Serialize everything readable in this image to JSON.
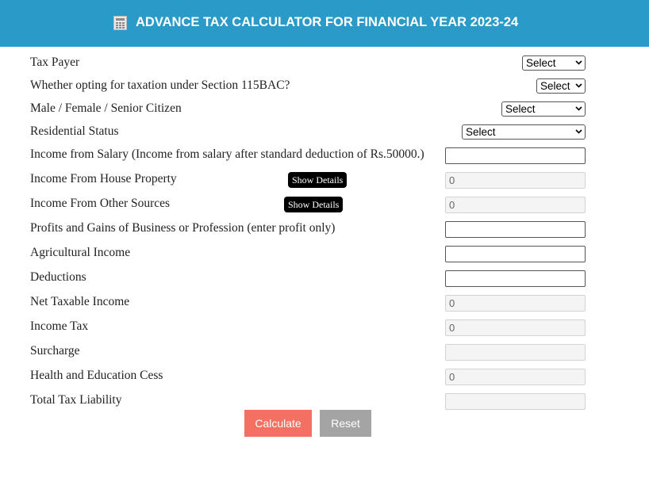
{
  "header": {
    "title": "ADVANCE TAX CALCULATOR FOR FINANCIAL YEAR 2023-24",
    "icon": "calculator-icon",
    "background": "#2a9ac8"
  },
  "form": {
    "tax_payer": {
      "label": "Tax Payer",
      "value": "Select"
    },
    "opting_115bac": {
      "label": "Whether opting for taxation under Section 115BAC?",
      "value": "Select"
    },
    "gender": {
      "label": "Male / Female / Senior Citizen",
      "value": "Select"
    },
    "residential_status": {
      "label": "Residential Status",
      "value": "Select"
    },
    "salary": {
      "label": "Income from Salary (Income from salary after standard deduction of Rs.50000.)",
      "value": ""
    },
    "house_property": {
      "label": "Income From House Property",
      "value": "0",
      "details_label": "Show Details"
    },
    "other_sources": {
      "label": "Income From Other Sources",
      "value": "0",
      "details_label": "Show Details"
    },
    "business": {
      "label": "Profits and Gains of Business or Profession (enter profit only)",
      "value": ""
    },
    "agricultural": {
      "label": "Agricultural Income",
      "value": ""
    },
    "deductions": {
      "label": "Deductions",
      "value": ""
    },
    "net_taxable": {
      "label": "Net Taxable Income",
      "value": "0"
    },
    "income_tax": {
      "label": "Income Tax",
      "value": "0"
    },
    "surcharge": {
      "label": "Surcharge",
      "value": ""
    },
    "cess": {
      "label": "Health and Education Cess",
      "value": "0"
    },
    "total_liability": {
      "label": "Total Tax Liability",
      "value": ""
    }
  },
  "actions": {
    "calculate_label": "Calculate",
    "reset_label": "Reset",
    "calculate_color": "#f37062",
    "reset_color": "#a4a4a4"
  }
}
